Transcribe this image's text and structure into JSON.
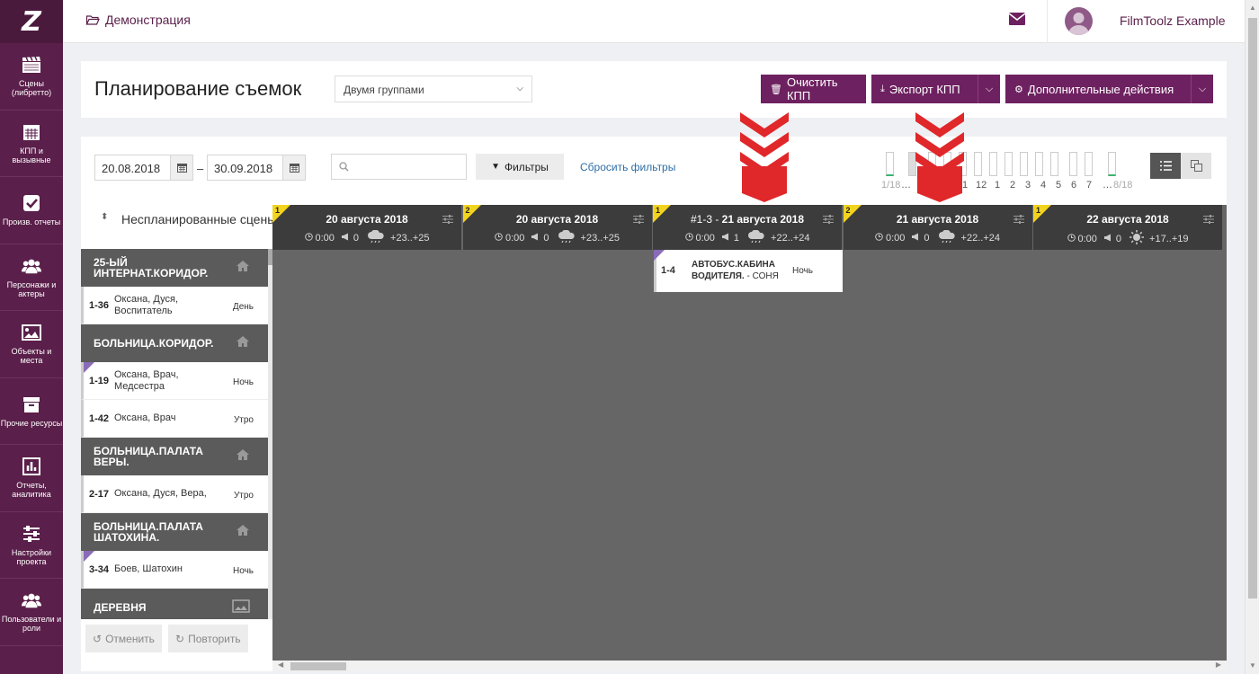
{
  "logo": "Z",
  "sidebar": {
    "items": [
      {
        "label": "Сцены (либретто)",
        "icon": "clapperboard-icon"
      },
      {
        "label": "КПП и вызывные",
        "icon": "calendar-icon"
      },
      {
        "label": "Произв. отчеты",
        "icon": "checkbox-icon"
      },
      {
        "label": "Персонажи и актеры",
        "icon": "users-icon"
      },
      {
        "label": "Объекты и места",
        "icon": "image-icon"
      },
      {
        "label": "Прочие ресурсы",
        "icon": "archive-icon"
      },
      {
        "label": "Отчеты, аналитика",
        "icon": "bar-chart-icon"
      },
      {
        "label": "Настройки проекта",
        "icon": "sliders-icon"
      },
      {
        "label": "Пользователи и роли",
        "icon": "users-icon"
      }
    ]
  },
  "topbar": {
    "breadcrumb": "Демонстрация",
    "username": "FilmToolz Example"
  },
  "page": {
    "title": "Планирование съемок",
    "group_select": "Двумя группами",
    "btn_clear": "Очистить КПП",
    "btn_export": "Экспорт КПП",
    "btn_more": "Дополнительные действия"
  },
  "filters": {
    "date_from": "20.08.2018",
    "date_sep": "–",
    "date_to": "30.09.2018",
    "search_placeholder": "",
    "btn_filters": "Фильтры",
    "reset": "Сбросить фильтры"
  },
  "histogram": {
    "labels": [
      "1/18",
      "…",
      "1",
      "12",
      "1",
      "2",
      "3",
      "4",
      "5",
      "6",
      "7",
      "…",
      "8/18"
    ]
  },
  "unscheduled": {
    "title": "Неспланированные сцены",
    "groups": [
      {
        "location": "25-ЫЙ ИНТЕРНАТ.КОРИДОР.",
        "icon": "home-icon",
        "scenes": [
          {
            "num": "1-36",
            "who": "Оксана, Дуся, Воспитатель",
            "tod": "День",
            "flag": false
          }
        ]
      },
      {
        "location": "БОЛЬНИЦА.КОРИДОР.",
        "icon": "home-icon",
        "scenes": [
          {
            "num": "1-19",
            "who": "Оксана, Врач, Медсестра",
            "tod": "Ночь",
            "flag": true
          },
          {
            "num": "1-42",
            "who": "Оксана, Врач",
            "tod": "Утро",
            "flag": false
          }
        ]
      },
      {
        "location": "БОЛЬНИЦА.ПАЛАТА ВЕРЫ.",
        "icon": "home-icon",
        "scenes": [
          {
            "num": "2-17",
            "who": "Оксана, Дуся, Вера,",
            "tod": "Утро",
            "flag": false
          }
        ]
      },
      {
        "location": "БОЛЬНИЦА.ПАЛАТА ШАТОХИНА.",
        "icon": "home-icon",
        "scenes": [
          {
            "num": "3-34",
            "who": "Боев, Шатохин",
            "tod": "Ночь",
            "flag": true
          }
        ]
      },
      {
        "location": "ДЕРЕВНЯ",
        "icon": "image-icon",
        "scenes": []
      }
    ],
    "btn_undo": "Отменить",
    "btn_redo": "Повторить"
  },
  "days": [
    {
      "group": "1",
      "prefix": "",
      "date": "20 августа 2018",
      "time": "0:00",
      "count": "0",
      "temp": "+23..+25",
      "weather": "cloud-rain"
    },
    {
      "group": "2",
      "prefix": "",
      "date": "20 августа 2018",
      "time": "0:00",
      "count": "0",
      "temp": "+23..+25",
      "weather": "cloud-rain"
    },
    {
      "group": "1",
      "prefix": "#1-3 - ",
      "date": "21 августа 2018",
      "time": "0:00",
      "count": "1",
      "temp": "+22..+24",
      "weather": "cloud-rain"
    },
    {
      "group": "2",
      "prefix": "",
      "date": "21 августа 2018",
      "time": "0:00",
      "count": "0",
      "temp": "+22..+24",
      "weather": "cloud-rain"
    },
    {
      "group": "1",
      "prefix": "",
      "date": "22 августа 2018",
      "time": "0:00",
      "count": "0",
      "temp": "+17..+19",
      "weather": "sun"
    }
  ],
  "scheduled_card": {
    "num": "1-4",
    "title": "АВТОБУС.КАБИНА ВОДИТЕЛЯ.",
    "who": " - СОНЯ",
    "tod": "Ночь"
  }
}
